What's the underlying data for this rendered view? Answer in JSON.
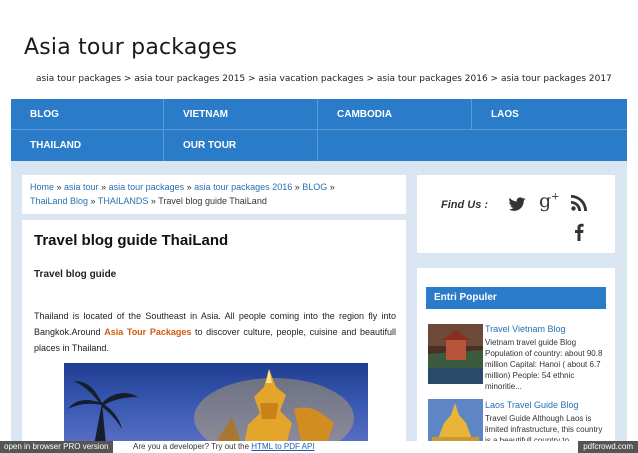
{
  "site": {
    "title": "Asia tour packages",
    "tagline": "asia tour packages > asia tour packages 2015 > asia vacation packages > asia tour packages 2016 > asia tour packages 2017"
  },
  "nav": {
    "row1": [
      "BLOG",
      "VIETNAM",
      "CAMBODIA",
      "LAOS"
    ],
    "row2": [
      "THAILAND",
      "OUR TOUR"
    ]
  },
  "breadcrumb": {
    "links": [
      "Home",
      "asia tour",
      "asia tour packages",
      "asia tour packages 2016",
      "BLOG",
      "ThaiLand Blog",
      "THAILANDS"
    ],
    "current": "Travel blog guide ThaiLand"
  },
  "post": {
    "title": "Travel blog guide ThaiLand",
    "subtitle": "Travel blog guide",
    "body_before": "Thailand is located of the Southeast in Asia. All people coming into the region fly into Bangkok.Around ",
    "highlight": "Asia Tour Packages",
    "body_after": " to discover culture, people, cuisine and beautifull places in  Thailand."
  },
  "sidebar": {
    "find_label": "Find Us :",
    "social_icons": [
      "twitter-icon",
      "google-plus-icon",
      "rss-icon",
      "facebook-icon"
    ],
    "popular_header": "Entri Populer",
    "popular": [
      {
        "title": "Travel Vietnam Blog",
        "desc": "Vietnam travel guide Blog Population of country: about 90.8 million  Capital: Hanoi ( about 6.7 million)  People: 54 ethnic minoritie..."
      },
      {
        "title": "Laos Travel Guide Blog",
        "desc": "Travel  Guide Although Laos is limited infrastructure, this country is a beautifull country to"
      }
    ]
  },
  "pdf_bar": {
    "left": "open in browser  PRO version",
    "msg": "Are you a developer? Try out the ",
    "link": "HTML to PDF API",
    "right": "pdfcrowd.com"
  },
  "colors": {
    "nav_bg": "#2a7bc8",
    "content_bg": "#d9e6f2",
    "link": "#2a6fb3",
    "highlight": "#d05a12"
  }
}
